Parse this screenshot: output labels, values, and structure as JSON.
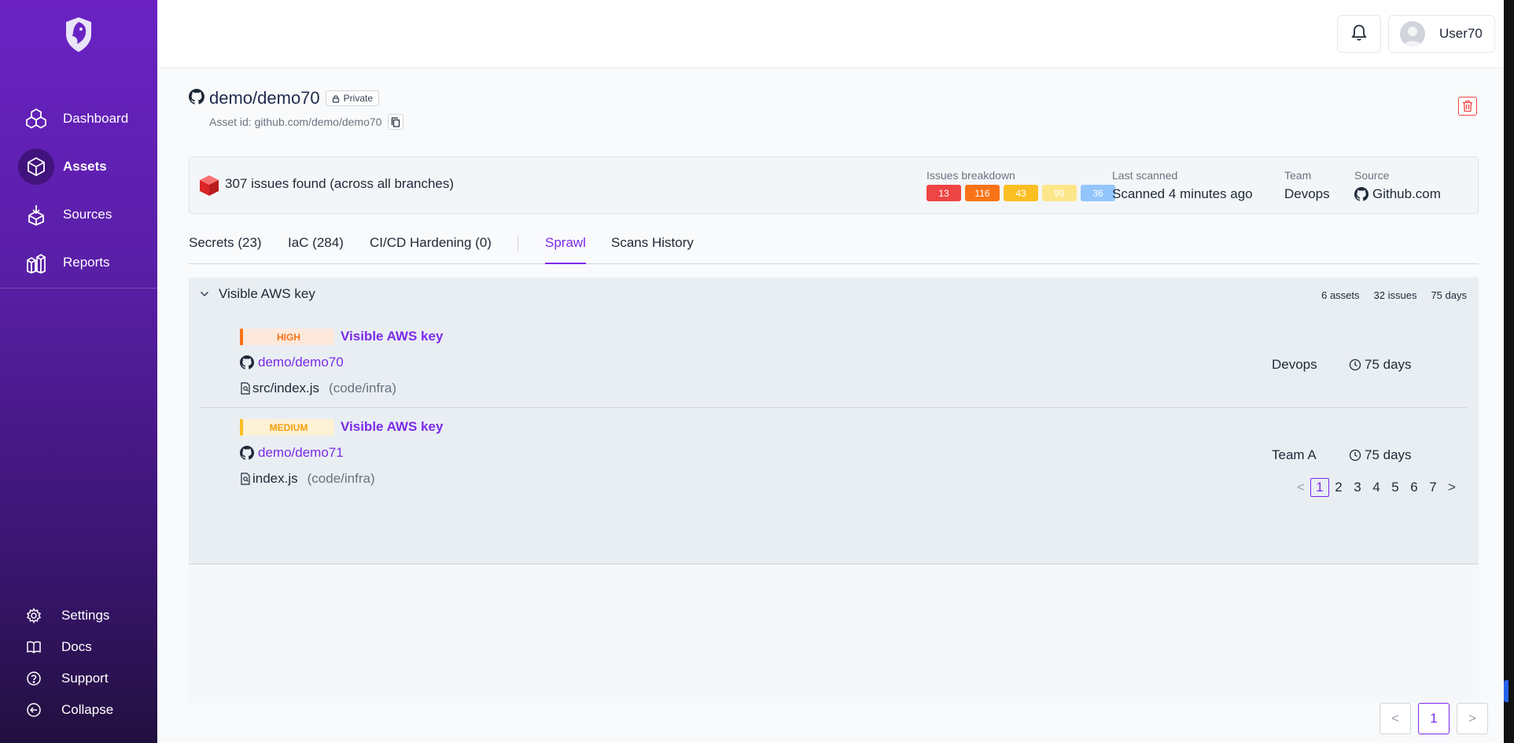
{
  "sidebar": {
    "logo": "shield-dragon-logo",
    "items": [
      {
        "label": "Dashboard",
        "icon": "cubes-icon"
      },
      {
        "label": "Assets",
        "icon": "cube-icon",
        "active": true
      },
      {
        "label": "Sources",
        "icon": "sources-icon"
      },
      {
        "label": "Reports",
        "icon": "reports-icon"
      }
    ],
    "bottom": [
      {
        "label": "Settings",
        "icon": "gear-icon"
      },
      {
        "label": "Docs",
        "icon": "book-icon"
      },
      {
        "label": "Support",
        "icon": "help-icon"
      },
      {
        "label": "Collapse",
        "icon": "collapse-icon"
      }
    ]
  },
  "topbar": {
    "notifications_icon": "bell-icon",
    "user_name": "User70"
  },
  "asset": {
    "name": "demo/demo70",
    "visibility": "Private",
    "asset_id": "Asset id: github.com/demo/demo70"
  },
  "summary": {
    "issues_found": "307 issues found (across all branches)",
    "breakdown_label": "Issues breakdown",
    "breakdown": [
      {
        "value": "13",
        "color": "#ef4444"
      },
      {
        "value": "116",
        "color": "#f97316"
      },
      {
        "value": "43",
        "color": "#fbbf24"
      },
      {
        "value": "99",
        "color": "#fde68a"
      },
      {
        "value": "36",
        "color": "#93c5fd"
      }
    ],
    "last_scanned_label": "Last scanned",
    "last_scanned": "Scanned 4 minutes ago",
    "team_label": "Team",
    "team": "Devops",
    "source_label": "Source",
    "source": "Github.com"
  },
  "tabs": [
    {
      "label": "Secrets (23)"
    },
    {
      "label": "IaC (284)"
    },
    {
      "label": "CI/CD Hardening (0)"
    },
    {
      "label": "Sprawl",
      "active": true
    },
    {
      "label": "Scans History"
    }
  ],
  "group": {
    "title": "Visible AWS key",
    "assets": "6 assets",
    "issues": "32 issues",
    "days": "75 days"
  },
  "findings": [
    {
      "severity": "HIGH",
      "title": "Visible AWS key",
      "repo": "demo/demo70",
      "file": "src/index.js",
      "file_meta": "(code/infra)",
      "team": "Devops",
      "age": "75 days"
    },
    {
      "severity": "MEDIUM",
      "title": "Visible AWS key",
      "repo": "demo/demo71",
      "file": "index.js",
      "file_meta": "(code/infra)",
      "team": "Team A",
      "age": "75 days"
    }
  ],
  "pager": {
    "prev": "<",
    "next": ">",
    "pages": [
      "1",
      "2",
      "3",
      "4",
      "5",
      "6",
      "7"
    ],
    "current": "1"
  },
  "bottom_pager": {
    "prev": "<",
    "current": "1",
    "next": ">"
  }
}
